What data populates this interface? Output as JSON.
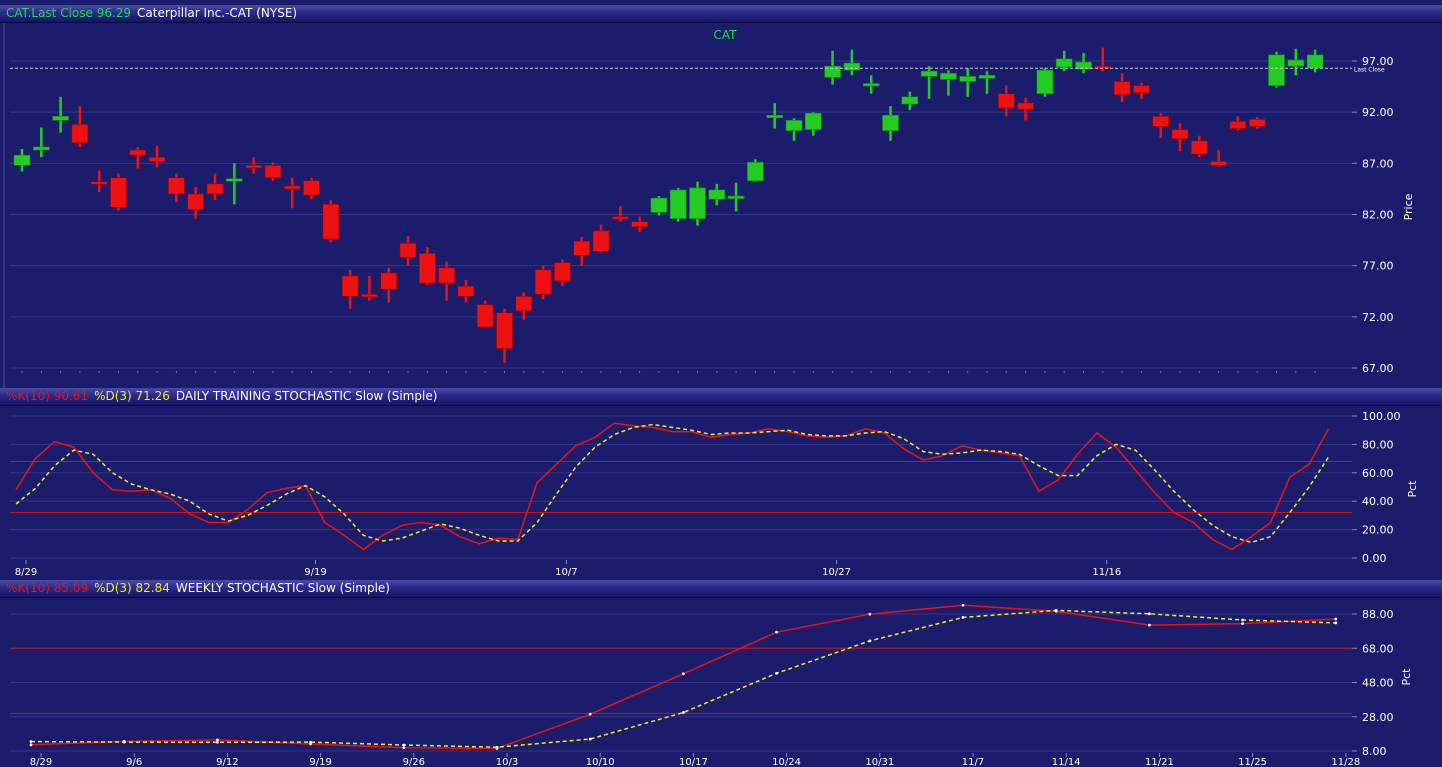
{
  "price_panel": {
    "header": {
      "symbol_last": "CAT.Last Close 96.29",
      "name": "Caterpillar Inc.-CAT (NYSE)"
    },
    "chart_title": "CAT",
    "y_label": "Price",
    "last_close_label": "Last Close",
    "y_ticks": [
      "97.00",
      "92.00",
      "87.00",
      "82.00",
      "77.00",
      "72.00",
      "67.00"
    ]
  },
  "daily_panel": {
    "header": {
      "k_label": "%K(10) 90.61",
      "d_label": "%D(3) 71.26",
      "title": "DAILY TRAINING STOCHASTIC Slow (Simple)"
    },
    "y_label": "Pct",
    "y_ticks": [
      "100.00",
      "80.00",
      "60.00",
      "40.00",
      "20.00",
      "0.00"
    ],
    "x_ticks": [
      "8/29",
      "9/19",
      "10/7",
      "10/27",
      "11/16"
    ]
  },
  "weekly_panel": {
    "header": {
      "k_label": "%K(10) 85.09",
      "d_label": "%D(3) 82.84",
      "title": "WEEKLY STOCHASTIC Slow (Simple)"
    },
    "y_label": "Pct",
    "y_ticks": [
      "88.00",
      "68.00",
      "48.00",
      "28.00",
      "8.00"
    ],
    "x_ticks": [
      "8/29",
      "9/6",
      "9/12",
      "9/19",
      "9/26",
      "10/3",
      "10/10",
      "10/17",
      "10/24",
      "10/31",
      "11/7",
      "11/14",
      "11/21",
      "11/25",
      "11/28"
    ]
  },
  "colors": {
    "background": "#1c1c6c",
    "grid": "#34348a",
    "up": "#22cc22",
    "down": "#ee1111",
    "k_line": "#ee1111",
    "d_line": "#eeee22",
    "band": "#cc1111",
    "header_green": "#22dd44",
    "header_white": "#ffffff"
  },
  "chart_data": [
    {
      "type": "candlestick",
      "title": "CAT",
      "ylabel": "Price",
      "ylim": [
        67,
        99
      ],
      "last_close": 96.29,
      "grid": true,
      "candles": [
        {
          "o": 86.8,
          "h": 88.4,
          "l": 86.2,
          "c": 87.8
        },
        {
          "o": 88.3,
          "h": 90.5,
          "l": 87.6,
          "c": 88.6
        },
        {
          "o": 91.2,
          "h": 93.5,
          "l": 90.0,
          "c": 91.6
        },
        {
          "o": 90.8,
          "h": 92.6,
          "l": 88.6,
          "c": 89.0
        },
        {
          "o": 85.2,
          "h": 86.3,
          "l": 84.2,
          "c": 85.0
        },
        {
          "o": 85.6,
          "h": 86.0,
          "l": 82.4,
          "c": 82.7
        },
        {
          "o": 88.3,
          "h": 88.6,
          "l": 86.5,
          "c": 87.8
        },
        {
          "o": 87.6,
          "h": 88.7,
          "l": 86.6,
          "c": 87.2
        },
        {
          "o": 85.6,
          "h": 86.0,
          "l": 83.2,
          "c": 84.0
        },
        {
          "o": 84.0,
          "h": 84.7,
          "l": 81.6,
          "c": 82.5
        },
        {
          "o": 85.0,
          "h": 86.0,
          "l": 83.4,
          "c": 84.0
        },
        {
          "o": 85.3,
          "h": 87.0,
          "l": 83.0,
          "c": 85.5
        },
        {
          "o": 86.8,
          "h": 87.6,
          "l": 86.0,
          "c": 86.7
        },
        {
          "o": 86.8,
          "h": 87.1,
          "l": 85.3,
          "c": 85.6
        },
        {
          "o": 84.8,
          "h": 85.6,
          "l": 82.6,
          "c": 84.5
        },
        {
          "o": 85.3,
          "h": 85.6,
          "l": 83.5,
          "c": 83.9
        },
        {
          "o": 83.0,
          "h": 83.4,
          "l": 79.3,
          "c": 79.6
        },
        {
          "o": 76.0,
          "h": 76.6,
          "l": 72.8,
          "c": 74.0
        },
        {
          "o": 74.2,
          "h": 76.0,
          "l": 73.6,
          "c": 74.0
        },
        {
          "o": 76.3,
          "h": 76.8,
          "l": 73.4,
          "c": 74.7
        },
        {
          "o": 79.2,
          "h": 79.9,
          "l": 77.0,
          "c": 77.8
        },
        {
          "o": 78.2,
          "h": 78.8,
          "l": 75.1,
          "c": 75.3
        },
        {
          "o": 76.8,
          "h": 77.4,
          "l": 73.6,
          "c": 75.3
        },
        {
          "o": 75.0,
          "h": 75.6,
          "l": 73.4,
          "c": 74.0
        },
        {
          "o": 73.2,
          "h": 73.6,
          "l": 71.0,
          "c": 71.0
        },
        {
          "o": 72.4,
          "h": 72.8,
          "l": 67.5,
          "c": 68.9
        },
        {
          "o": 74.0,
          "h": 74.4,
          "l": 71.7,
          "c": 72.6
        },
        {
          "o": 76.6,
          "h": 77.0,
          "l": 73.7,
          "c": 74.2
        },
        {
          "o": 77.3,
          "h": 77.6,
          "l": 75.0,
          "c": 75.5
        },
        {
          "o": 79.4,
          "h": 79.8,
          "l": 77.0,
          "c": 78.0
        },
        {
          "o": 80.4,
          "h": 81.0,
          "l": 78.3,
          "c": 78.4
        },
        {
          "o": 81.8,
          "h": 82.8,
          "l": 81.3,
          "c": 81.7
        },
        {
          "o": 81.3,
          "h": 81.8,
          "l": 80.3,
          "c": 80.8
        },
        {
          "o": 82.2,
          "h": 83.8,
          "l": 81.9,
          "c": 83.6
        },
        {
          "o": 81.6,
          "h": 84.6,
          "l": 81.3,
          "c": 84.4
        },
        {
          "o": 81.6,
          "h": 85.2,
          "l": 80.9,
          "c": 84.6
        },
        {
          "o": 83.5,
          "h": 85.0,
          "l": 82.9,
          "c": 84.4
        },
        {
          "o": 83.7,
          "h": 85.1,
          "l": 82.3,
          "c": 83.8
        },
        {
          "o": 85.3,
          "h": 87.4,
          "l": 85.2,
          "c": 87.1
        },
        {
          "o": 91.6,
          "h": 92.9,
          "l": 90.4,
          "c": 91.7
        },
        {
          "o": 90.2,
          "h": 91.4,
          "l": 89.2,
          "c": 91.2
        },
        {
          "o": 90.3,
          "h": 92.0,
          "l": 89.7,
          "c": 91.9
        },
        {
          "o": 95.4,
          "h": 98.0,
          "l": 94.7,
          "c": 96.5
        },
        {
          "o": 96.1,
          "h": 98.1,
          "l": 95.6,
          "c": 96.8
        },
        {
          "o": 94.7,
          "h": 95.6,
          "l": 93.8,
          "c": 94.8
        },
        {
          "o": 90.2,
          "h": 92.6,
          "l": 89.2,
          "c": 91.7
        },
        {
          "o": 92.8,
          "h": 94.0,
          "l": 92.2,
          "c": 93.5
        },
        {
          "o": 95.5,
          "h": 96.5,
          "l": 93.3,
          "c": 96.0
        },
        {
          "o": 95.2,
          "h": 96.1,
          "l": 93.6,
          "c": 95.8
        },
        {
          "o": 95.0,
          "h": 96.3,
          "l": 93.5,
          "c": 95.5
        },
        {
          "o": 95.3,
          "h": 96.0,
          "l": 93.8,
          "c": 95.6
        },
        {
          "o": 93.8,
          "h": 94.6,
          "l": 91.6,
          "c": 92.4
        },
        {
          "o": 92.9,
          "h": 93.4,
          "l": 91.2,
          "c": 92.3
        },
        {
          "o": 93.8,
          "h": 96.3,
          "l": 93.5,
          "c": 96.1
        },
        {
          "o": 96.4,
          "h": 98.0,
          "l": 96.0,
          "c": 97.2
        },
        {
          "o": 96.2,
          "h": 97.8,
          "l": 95.8,
          "c": 96.9
        },
        {
          "o": 96.5,
          "h": 98.3,
          "l": 96.0,
          "c": 96.4
        },
        {
          "o": 95.0,
          "h": 95.8,
          "l": 93.0,
          "c": 93.7
        },
        {
          "o": 94.6,
          "h": 94.9,
          "l": 93.3,
          "c": 93.9
        },
        {
          "o": 91.6,
          "h": 91.9,
          "l": 89.5,
          "c": 90.6
        },
        {
          "o": 90.3,
          "h": 90.9,
          "l": 88.2,
          "c": 89.4
        },
        {
          "o": 89.2,
          "h": 89.7,
          "l": 87.6,
          "c": 87.9
        },
        {
          "o": 87.2,
          "h": 88.3,
          "l": 86.7,
          "c": 86.8
        },
        {
          "o": 91.1,
          "h": 91.6,
          "l": 90.2,
          "c": 90.4
        },
        {
          "o": 91.3,
          "h": 91.5,
          "l": 90.4,
          "c": 90.6
        },
        {
          "o": 94.6,
          "h": 97.9,
          "l": 94.4,
          "c": 97.6
        },
        {
          "o": 96.5,
          "h": 98.2,
          "l": 95.6,
          "c": 97.1
        },
        {
          "o": 96.3,
          "h": 98.1,
          "l": 95.9,
          "c": 97.6
        }
      ]
    },
    {
      "type": "line",
      "title": "DAILY TRAINING STOCHASTIC Slow (Simple)",
      "ylabel": "Pct",
      "ylim": [
        0,
        100
      ],
      "bands": [
        68,
        32
      ],
      "x_tick_labels": [
        "8/29",
        "9/19",
        "10/7",
        "10/27",
        "11/16"
      ],
      "x_tick_index": [
        0,
        15,
        28,
        42,
        56
      ],
      "series": [
        {
          "name": "%K(10) 90.61",
          "values": [
            48,
            70,
            82,
            78,
            60,
            48,
            47,
            48,
            42,
            31,
            25,
            25,
            34,
            46,
            49,
            51,
            25,
            16,
            6,
            16,
            23,
            25,
            23,
            15,
            10,
            14,
            13,
            53,
            66,
            79,
            85,
            95,
            93,
            92,
            89,
            89,
            85,
            87,
            88,
            91,
            89,
            86,
            85,
            86,
            91,
            88,
            77,
            69,
            72,
            79,
            76,
            74,
            72,
            47,
            55,
            73,
            88,
            78,
            62,
            46,
            32,
            25,
            13,
            6,
            15,
            25,
            57,
            66,
            91
          ]
        },
        {
          "name": "%D(3) 71.26",
          "values": [
            38,
            49,
            65,
            76,
            73,
            60,
            52,
            48,
            45,
            40,
            31,
            26,
            30,
            37,
            45,
            51,
            43,
            31,
            16,
            12,
            14,
            19,
            24,
            21,
            16,
            12,
            12,
            25,
            45,
            64,
            78,
            87,
            92,
            94,
            92,
            90,
            87,
            88,
            88,
            89,
            90,
            87,
            86,
            86,
            88,
            89,
            84,
            75,
            73,
            74,
            76,
            75,
            73,
            65,
            58,
            58,
            72,
            80,
            76,
            62,
            47,
            34,
            23,
            15,
            11,
            15,
            32,
            50,
            71
          ]
        }
      ]
    },
    {
      "type": "line",
      "title": "WEEKLY STOCHASTIC Slow (Simple)",
      "ylabel": "Pct",
      "ylim": [
        8,
        96
      ],
      "bands": [
        68,
        30
      ],
      "categories": [
        "8/29",
        "9/6",
        "9/12",
        "9/19",
        "9/26",
        "10/3",
        "10/10",
        "10/17",
        "10/24",
        "10/31",
        "11/7",
        "11/14",
        "11/21",
        "11/25",
        "11/28"
      ],
      "series": [
        {
          "name": "%K(10) 85.09",
          "values": [
            11.6,
            13.6,
            14.5,
            12.1,
            9.9,
            9.5,
            29.5,
            53.1,
            77.4,
            87.9,
            93.1,
            89.6,
            81.5,
            82.4,
            85.1
          ]
        },
        {
          "name": "%D(3) 82.84",
          "values": [
            13.5,
            13.2,
            13.1,
            13.2,
            11.5,
            10.2,
            15.0,
            30.5,
            53.4,
            72.3,
            86.0,
            90.1,
            88.1,
            84.5,
            82.8
          ]
        }
      ]
    }
  ]
}
